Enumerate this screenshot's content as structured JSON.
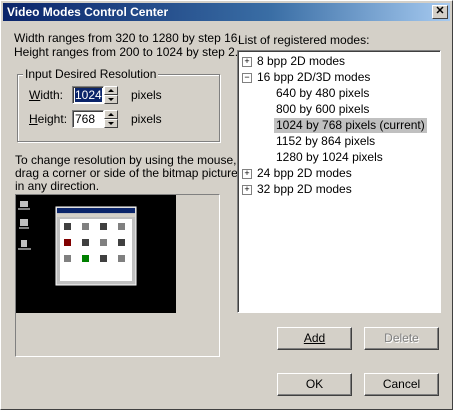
{
  "window": {
    "title": "Video Modes Control Center",
    "close_glyph": "✕"
  },
  "ranges": {
    "width_text": "Width ranges from 320 to 1280 by step 16.",
    "height_text": "Height ranges from  200 to 1024 by step 2."
  },
  "resolution_group": {
    "title": "Input Desired Resolution",
    "width_label": "Width:",
    "width_value": "1024",
    "height_label": "Height:",
    "height_value": "768",
    "unit": "pixels"
  },
  "instructions": {
    "line1": "To change resolution by using the mouse,",
    "line2": "drag a corner or side of the bitmap picture",
    "line3": "in any direction."
  },
  "modes": {
    "label": "List of registered modes:",
    "items": [
      {
        "label": "8 bpp 2D modes",
        "expander": "+"
      },
      {
        "label": "16 bpp 2D/3D modes",
        "expander": "−"
      },
      {
        "label": "640 by 480 pixels"
      },
      {
        "label": "800 by 600 pixels"
      },
      {
        "label": "1024 by 768 pixels (current)"
      },
      {
        "label": "1152 by 864 pixels"
      },
      {
        "label": "1280 by 1024 pixels"
      },
      {
        "label": "24 bpp 2D modes",
        "expander": "+"
      },
      {
        "label": "32 bpp 2D modes",
        "expander": "+"
      }
    ],
    "selected_index": 4
  },
  "buttons": {
    "add": "Add",
    "delete": "Delete",
    "ok": "OK",
    "cancel": "Cancel"
  },
  "colors": {
    "titlebar": "#0a246a",
    "face": "#d4d0c8",
    "selection": "#0a246a"
  }
}
